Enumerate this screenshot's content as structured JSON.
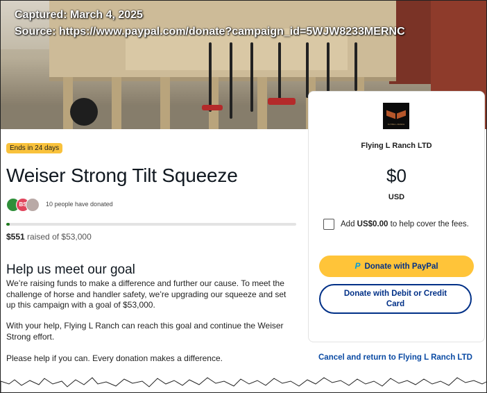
{
  "overlay": {
    "captured": "Captured: March 4, 2025",
    "source": "Source: https://www.paypal.com/donate?campaign_id=5WJW8233MERNC"
  },
  "campaign": {
    "badge": "Ends in 24 days",
    "title": "Weiser Strong Tilt Squeeze",
    "donors_text": "10 people have donated",
    "avatars": [
      {
        "initials": "",
        "color": "#2f8f3a"
      },
      {
        "initials": "BS",
        "color": "#e0445c"
      },
      {
        "initials": "",
        "color": "#b9a9a6"
      }
    ],
    "progress_fraction": 0.0104,
    "raised_amount": "$551",
    "raised_suffix": "raised of $53,000",
    "goal_heading": "Help us meet our goal",
    "paragraphs": [
      "We’re raising funds to make a difference and further our cause. To meet the challenge of horse and handler safety, we’re upgrading our squeeze and set up this campaign with a goal of $53,000.",
      "With your help, Flying L Ranch can reach this goal and continue the Weiser Strong effort.",
      "Please help if you can. Every donation makes a difference."
    ]
  },
  "donate_card": {
    "logo_text": "FLYING L RANCH",
    "org_name": "Flying L Ranch LTD",
    "amount": "$0",
    "currency": "USD",
    "fee_prefix": "Add ",
    "fee_amount": "US$0.00",
    "fee_suffix": " to help cover the fees.",
    "paypal_button": "Donate with PayPal",
    "card_button": "Donate with Debit or Credit Card",
    "cancel_link": "Cancel and return to Flying L Ranch LTD"
  },
  "colors": {
    "badge": "#f9c23c",
    "paypal_yellow": "#ffc439",
    "paypal_blue": "#003087",
    "link_blue": "#0a4aa3",
    "progress_green": "#1f7a1f"
  }
}
